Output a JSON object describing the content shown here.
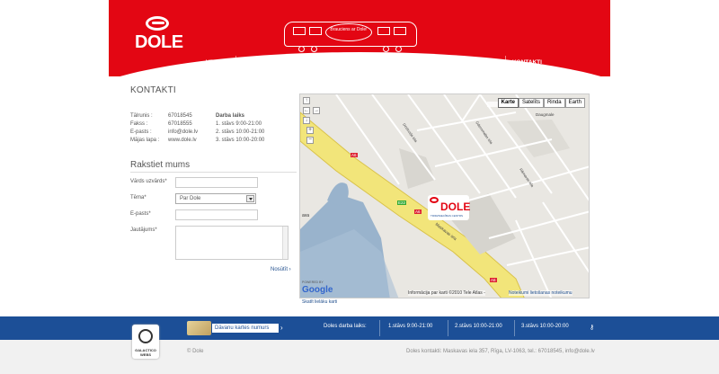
{
  "header": {
    "logo_text": "DOLE",
    "tram_badge": "Brauciens ar Dole!",
    "nav": [
      "VEIKALI",
      "PRIVILĒĢIJU KARTE",
      "DĀVANU KARTE",
      "AKCIJAS",
      "AKTUALITĀTES",
      "PAR DOLI",
      "KONTAKTI"
    ]
  },
  "contact": {
    "title": "KONTAKTI",
    "rows": [
      {
        "k": "Tālrunis :",
        "v": "67018545"
      },
      {
        "k": "Fakss :",
        "v": "67018555"
      },
      {
        "k": "E-pasts :",
        "v": "info@dole.lv"
      },
      {
        "k": "Mājas lapa :",
        "v": "www.dole.lv"
      }
    ],
    "hours_title": "Darba laiks",
    "hours": [
      "1. stāvs 9:00-21:00",
      "2. stāvs 10:00-21:00",
      "3. stāvs 10:00-20:00"
    ]
  },
  "form": {
    "title": "Rakstiet mums",
    "name_label": "Vārds uzvārds*",
    "name_value": "",
    "topic_label": "Tēma*",
    "topic_value": "Par Dole",
    "email_label": "E-pasts*",
    "email_value": "",
    "question_label": "Jautājums*",
    "question_value": "",
    "send_label": "Nosūtīt ›"
  },
  "map": {
    "types": [
      "Karte",
      "Satelīts",
      "Rinda",
      "Earth"
    ],
    "active_type": "Karte",
    "road_labels": [
      "A6",
      "A6",
      "A6",
      "E22"
    ],
    "street_labels": [
      "Maskavas iela",
      "Ūdensmalas iela",
      "Dzelzceļa iela",
      "Rāmavas iela"
    ],
    "place_label": "Daugmale",
    "logo_text": "DOLE",
    "logo_sub": "TIRDZNIECĪBAS CENTRS",
    "attribution": "Informācija par karti ©2010 Tele Atlas -",
    "terms": "Noteikumi lietošanas noteikumu",
    "powered": "POWERED BY",
    "google": "Google",
    "larger_link": "Skatīt lielāku karti",
    "water_label": "ava"
  },
  "footer": {
    "card_label": "Dāvanu kartes numurs",
    "hours_title": "Doles darba laiks:",
    "hours": [
      "1.stāvs 9:00-21:00",
      "2.stāvs 10:00-21:00",
      "3.stāvs 10:00-20:00"
    ],
    "copyright": "© Dole",
    "address": "Doles kontakti: Maskavas iela 357, Rīga, LV-1063, tel.: 67018545, info@dole.lv",
    "partner": "GALACTICO WEBS"
  },
  "colors": {
    "brand_red": "#e30613",
    "footer_blue": "#1c4f97",
    "link": "#1f4e8c"
  }
}
